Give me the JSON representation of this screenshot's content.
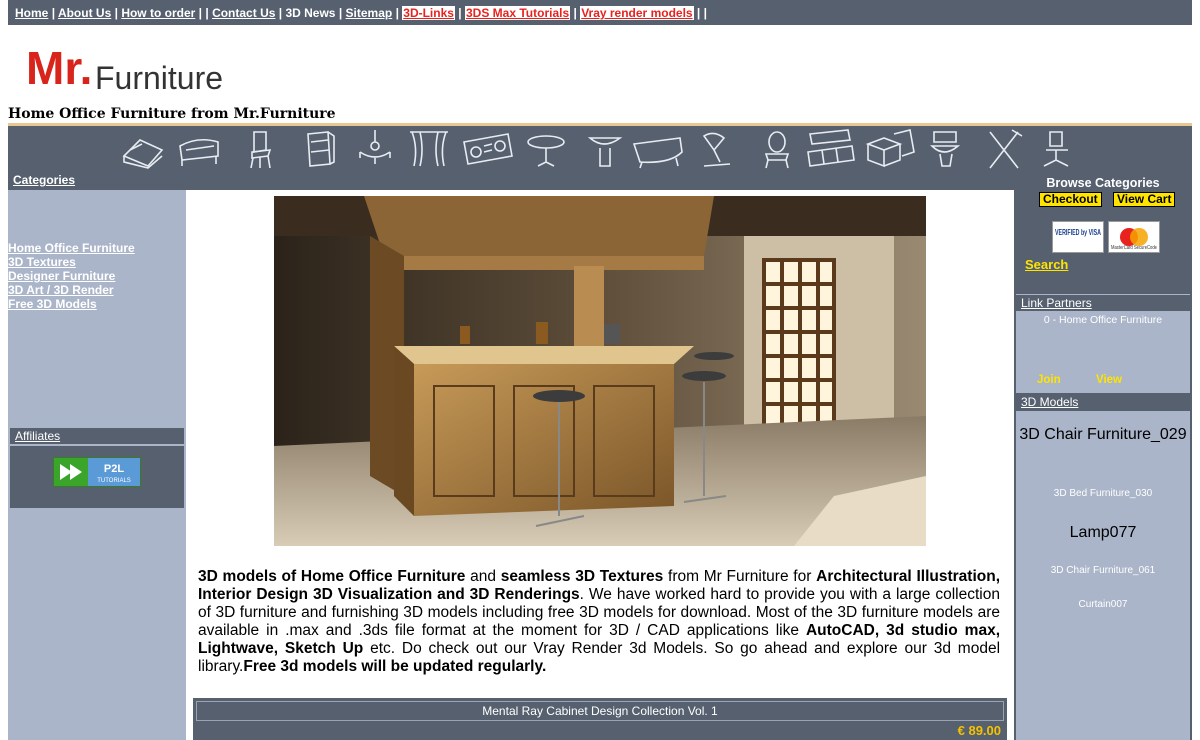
{
  "topnav": {
    "home": "Home",
    "about": "About Us",
    "howto": "How to order",
    "contact": "Contact Us",
    "news": "3D News",
    "sitemap": "Sitemap",
    "links3d": "3D-Links",
    "max_tutorials": "3DS Max Tutorials",
    "vray": "Vray render models",
    "sep": "|",
    "sep_double": "| |",
    "sep_end": "| |"
  },
  "logo": {
    "mr": "Mr.",
    "furniture": "Furniture"
  },
  "tagline": "Home Office Furniture from Mr.Furniture",
  "categories_link": "Categories",
  "left_links": [
    "Home Office Furniture",
    "3D Textures",
    "Designer Furniture",
    "3D Art / 3D Render",
    "Free 3D Models"
  ],
  "affiliates": {
    "title": "Affiliates",
    "banner_text": "P2L",
    "banner_sub": "TUTORIALS"
  },
  "right": {
    "browse": "Browse Categories",
    "checkout": "Checkout",
    "view_cart": "View Cart",
    "visa_text": "VERIFIED by VISA",
    "mc_text": "MasterCard SecureCode",
    "search": "Search",
    "link_partners": "Link Partners",
    "partner_item": "0 - Home Office Furniture",
    "join": "Join",
    "view": "View",
    "models_title": "3D Models",
    "models": [
      {
        "name": "3D Chair Furniture_029"
      },
      {
        "name": "3D Bed Furniture_030"
      },
      {
        "name": "Lamp077"
      },
      {
        "name": "3D Chair Furniture_061"
      },
      {
        "name": "Curtain007"
      }
    ]
  },
  "main": {
    "desc_parts": {
      "b1": "3D models of Home Office Furniture",
      "t1": " and ",
      "b2": "seamless 3D Textures",
      "t2": " from Mr Furniture for ",
      "b3": "Architectural Illustration, Interior Design 3D Visualization and 3D Renderings",
      "t3": ". We have worked hard to provide you with a large collection of 3D furniture and furnishing 3D models including free 3D models for download. Most of the 3D furniture models are available in .max and .3ds file format at the moment for 3D / CAD applications like ",
      "b4": "AutoCAD, 3d studio max, Lightwave, Sketch Up",
      "t4": " etc. Do check out our Vray Render 3d Models. So go ahead and explore our 3d model library.",
      "b5": "Free 3d models will be updated regularly."
    },
    "product_title": "Mental Ray Cabinet Design Collection Vol. 1",
    "product_price": "€ 89.00"
  },
  "colors": {
    "nav_bg": "#56606f",
    "side_bg": "#aab5c9",
    "accent_yellow": "#ffe400",
    "link_red": "#e8231d"
  },
  "icons": [
    "bed-icon",
    "sofa-icon",
    "chair-icon",
    "cabinet-icon",
    "chandelier-icon",
    "curtain-icon",
    "stereo-icon",
    "table-icon",
    "sink-icon",
    "bathtub-icon",
    "lamp-icon",
    "mirror-icon",
    "kitchen-icon",
    "boxes-icon",
    "toilet-icon",
    "cutlery-icon",
    "office-chair-icon"
  ]
}
